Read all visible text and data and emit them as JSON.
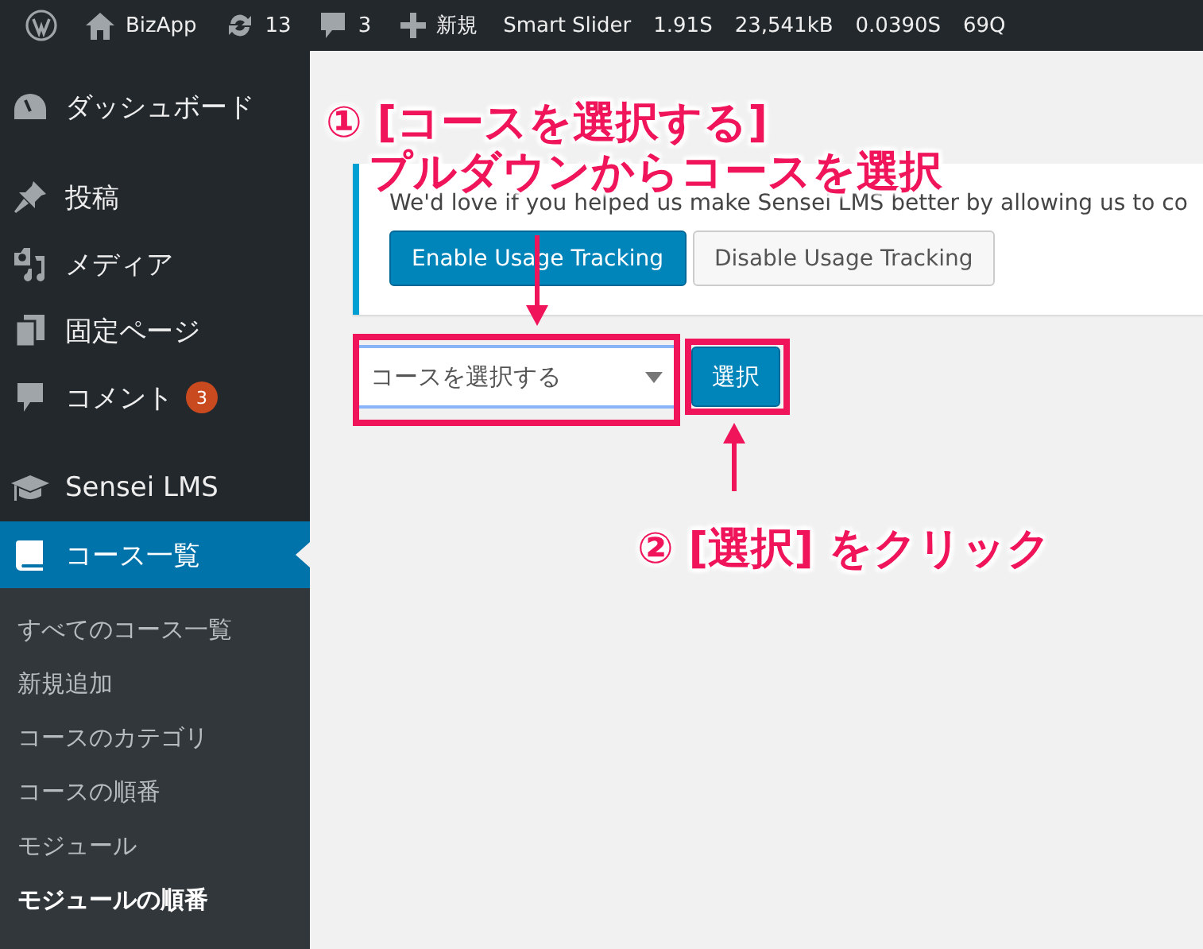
{
  "admin_bar": {
    "items": [
      {
        "kind": "logo"
      },
      {
        "kind": "home",
        "label": "BizApp"
      },
      {
        "kind": "updates",
        "label": "13"
      },
      {
        "kind": "comments",
        "label": "3"
      },
      {
        "kind": "new",
        "label": "新規"
      },
      {
        "kind": "text",
        "label": "Smart Slider"
      },
      {
        "kind": "text",
        "label": "1.91S"
      },
      {
        "kind": "text",
        "label": "23,541kB"
      },
      {
        "kind": "text",
        "label": "0.0390S"
      },
      {
        "kind": "text",
        "label": "69Q"
      }
    ]
  },
  "sidebar": {
    "menu_groups": [
      [
        {
          "kind": "dashboard",
          "label": "ダッシュボード",
          "selected": false
        }
      ],
      [
        {
          "kind": "pin",
          "label": "投稿",
          "selected": false
        },
        {
          "kind": "media",
          "label": "メディア",
          "selected": false
        },
        {
          "kind": "pages",
          "label": "固定ページ",
          "selected": false
        },
        {
          "kind": "comment",
          "label": "コメント",
          "badge": "3",
          "selected": false
        }
      ],
      [
        {
          "kind": "cap",
          "label": "Sensei LMS",
          "selected": false
        },
        {
          "kind": "book",
          "label": "コース一覧",
          "selected": true
        }
      ]
    ],
    "submenu": [
      {
        "label": "すべてのコース一覧",
        "selected": false
      },
      {
        "label": "新規追加",
        "selected": false
      },
      {
        "label": "コースのカテゴリ",
        "selected": false
      },
      {
        "label": "コースの順番",
        "selected": false
      },
      {
        "label": "モジュール",
        "selected": false
      },
      {
        "label": "モジュールの順番",
        "selected": true
      }
    ]
  },
  "notice": {
    "text": "We'd love if you helped us make Sensei LMS better by allowing us to co",
    "buttons": [
      {
        "label": "Enable Usage Tracking",
        "kind": "primary"
      },
      {
        "label": "Disable Usage Tracking",
        "kind": "secondary"
      }
    ]
  },
  "course_picker": {
    "value": "コースを選択する",
    "button": "選択"
  },
  "annotations": [
    {
      "lines": [
        "① [コースを選択する]",
        "プルダウンからコースを選択"
      ]
    },
    {
      "lines": [
        "② [選択] をクリック"
      ]
    }
  ]
}
